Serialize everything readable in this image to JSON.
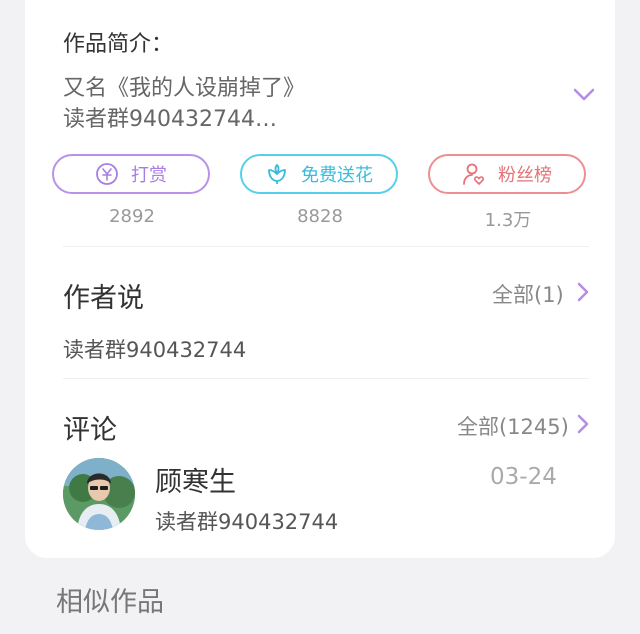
{
  "intro": {
    "title": "作品简介：",
    "line1": "又名《我的人设崩掉了》",
    "line2": "读者群940432744…"
  },
  "actions": {
    "reward": {
      "label": "打赏",
      "count": "2892",
      "icon": "coin-icon"
    },
    "flower": {
      "label": "免费送花",
      "count": "8828",
      "icon": "flower-icon"
    },
    "fans": {
      "label": "粉丝榜",
      "count": "1.3万",
      "icon": "fan-heart-icon"
    }
  },
  "author_says": {
    "title": "作者说",
    "more": "全部(1)",
    "text": "读者群940432744"
  },
  "comments": {
    "title": "评论",
    "more": "全部(1245)",
    "items": [
      {
        "user": "顾寒生",
        "date": "03-24",
        "text": "读者群940432744"
      }
    ]
  },
  "similar": {
    "title": "相似作品"
  },
  "colors": {
    "reward": "#b792e8",
    "flower": "#56cfe9",
    "fans": "#ec8f93",
    "accent_chevron": "#b58be6"
  }
}
